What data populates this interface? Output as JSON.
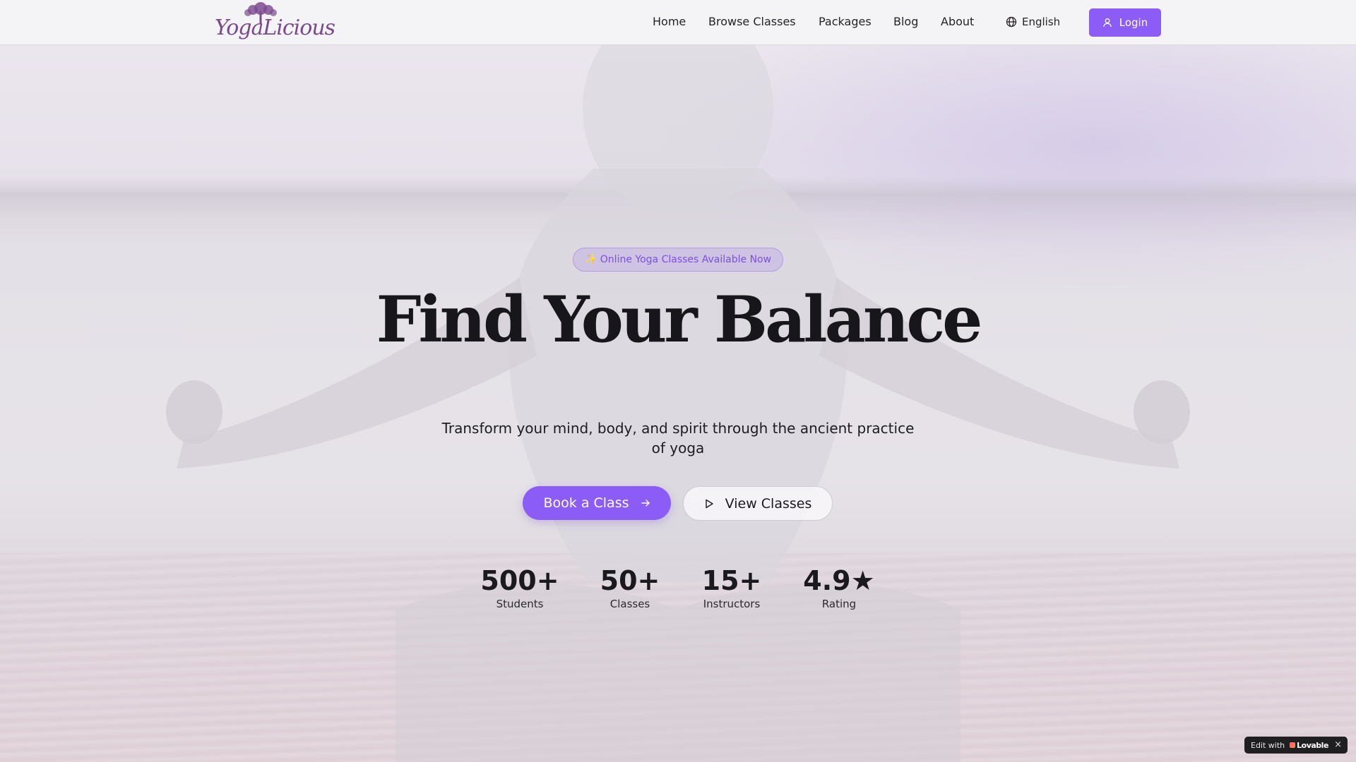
{
  "header": {
    "logo_text": "YogaLicious",
    "nav": [
      {
        "label": "Home"
      },
      {
        "label": "Browse Classes"
      },
      {
        "label": "Packages"
      },
      {
        "label": "Blog"
      },
      {
        "label": "About"
      }
    ],
    "language": "English",
    "login_label": "Login"
  },
  "hero": {
    "badge": "✨ Online Yoga Classes Available Now",
    "headline": "Find Your Balance",
    "subtitle": "Transform your mind, body, and spirit through the ancient practice of yoga",
    "cta_primary": "Book a Class",
    "cta_secondary": "View Classes",
    "stats": [
      {
        "value": "500+",
        "label": "Students"
      },
      {
        "value": "50+",
        "label": "Classes"
      },
      {
        "value": "15+",
        "label": "Instructors"
      },
      {
        "value": "4.9★",
        "label": "Rating"
      }
    ]
  },
  "lovable": {
    "prefix": "Edit with",
    "brand": "Lovable",
    "close": "×"
  },
  "colors": {
    "accent": "#8b5cf6",
    "header_bg": "#f4f3f5",
    "badge_text": "#7c4fe0"
  },
  "icons": {
    "language": "globe-icon",
    "login": "user-icon",
    "cta_primary": "arrow-right-icon",
    "cta_secondary": "play-icon"
  }
}
